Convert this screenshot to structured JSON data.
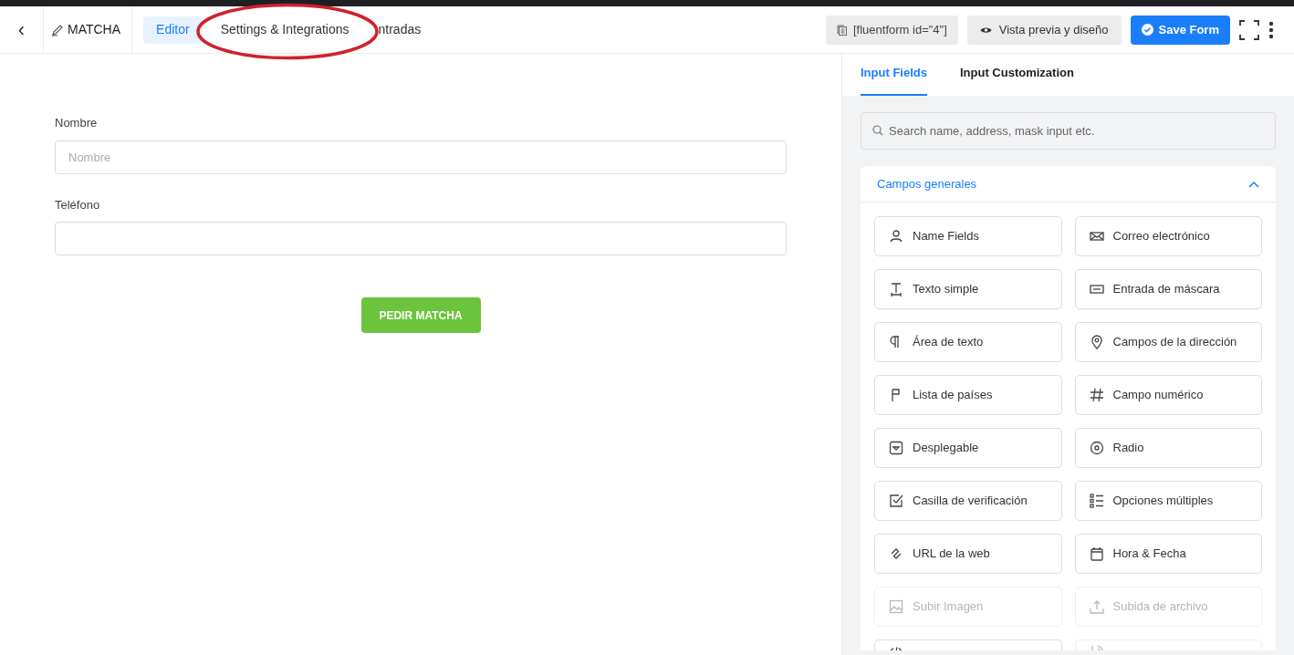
{
  "header": {
    "back": "‹",
    "form_title": "MATCHA",
    "tabs": [
      {
        "label": "Editor",
        "selected": true
      },
      {
        "label": "Settings & Integrations",
        "selected": false,
        "circled": true
      },
      {
        "label": "ntradas",
        "selected": false
      }
    ],
    "shortcode": "[fluentform id=\"4\"]",
    "preview": "Vista previa y diseño",
    "save": "Save Form"
  },
  "form": {
    "fields": [
      {
        "label": "Nombre",
        "placeholder": "Nombre"
      },
      {
        "label": "Teléfono"
      }
    ],
    "submit": "PEDIR MATCHA"
  },
  "panel": {
    "tabs": [
      {
        "label": "Input Fields",
        "selected": true
      },
      {
        "label": "Input Customization",
        "selected": false
      }
    ],
    "search": {
      "placeholder": "Search name, address, mask input etc."
    },
    "section": {
      "title": "Campos generales",
      "expanded": true,
      "items": [
        {
          "label": "Name Fields",
          "kind": "person",
          "disabled": false
        },
        {
          "label": "Correo electrónico",
          "kind": "mail",
          "disabled": false
        },
        {
          "label": "Texto simple",
          "kind": "text",
          "disabled": false
        },
        {
          "label": "Entrada de máscara",
          "kind": "mask",
          "disabled": false
        },
        {
          "label": "Área de texto",
          "kind": "paragraph",
          "disabled": false
        },
        {
          "label": "Campos de la dirección",
          "kind": "pin",
          "disabled": false
        },
        {
          "label": "Lista de países",
          "kind": "flag",
          "disabled": false
        },
        {
          "label": "Campo numérico",
          "kind": "hash",
          "disabled": false
        },
        {
          "label": "Desplegable",
          "kind": "dropdown",
          "disabled": false
        },
        {
          "label": "Radio",
          "kind": "radio",
          "disabled": false
        },
        {
          "label": "Casilla de verificación",
          "kind": "checkbox",
          "disabled": false
        },
        {
          "label": "Opciones múltiples",
          "kind": "list",
          "disabled": false
        },
        {
          "label": "URL de la web",
          "kind": "link",
          "disabled": false
        },
        {
          "label": "Hora & Fecha",
          "kind": "calendar",
          "disabled": false
        },
        {
          "label": "Subir Imagen",
          "kind": "image",
          "disabled": true
        },
        {
          "label": "Subida de archivo",
          "kind": "upload",
          "disabled": true
        },
        {
          "kind": "code",
          "disabled": false,
          "partial": true
        },
        {
          "kind": "phone",
          "disabled": true,
          "partial": true
        }
      ]
    }
  }
}
